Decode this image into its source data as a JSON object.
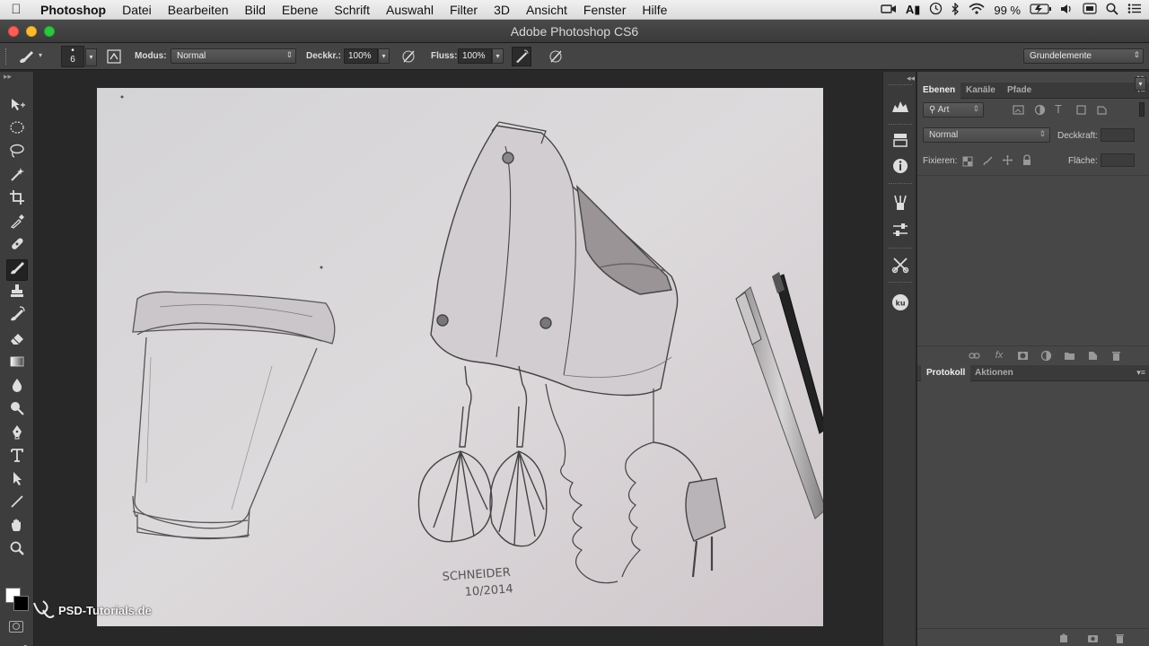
{
  "menubar": {
    "app_name": "Photoshop",
    "items": [
      "Datei",
      "Bearbeiten",
      "Bild",
      "Ebene",
      "Schrift",
      "Auswahl",
      "Filter",
      "3D",
      "Ansicht",
      "Fenster",
      "Hilfe"
    ],
    "battery": "99 %"
  },
  "window": {
    "title": "Adobe Photoshop CS6"
  },
  "options": {
    "brush_size": "6",
    "modus_label": "Modus:",
    "modus_value": "Normal",
    "deckkraft_label": "Deckkr.:",
    "deckkraft_value": "100%",
    "fluss_label": "Fluss:",
    "fluss_value": "100%",
    "workspace_value": "Grundelemente"
  },
  "tools": {
    "names": [
      "move-tool",
      "elliptical-marquee-tool",
      "lasso-tool",
      "magic-wand-tool",
      "crop-tool",
      "eyedropper-tool",
      "spot-healing-tool",
      "brush-tool",
      "clone-stamp-tool",
      "history-brush-tool",
      "eraser-tool",
      "gradient-tool",
      "blur-tool",
      "dodge-tool",
      "pen-tool",
      "type-tool",
      "path-selection-tool",
      "line-tool",
      "hand-tool",
      "zoom-tool"
    ],
    "active": "brush-tool"
  },
  "layers_panel": {
    "tabs": [
      "Ebenen",
      "Kanäle",
      "Pfade"
    ],
    "filter_value": "Art",
    "blend_mode": "Normal",
    "opacity_label": "Deckkraft:",
    "lock_label": "Fixieren:",
    "fill_label": "Fläche:"
  },
  "history_panel": {
    "tabs": [
      "Protokoll",
      "Aktionen"
    ]
  },
  "canvas": {
    "signature_line1": "SCHNEIDER",
    "signature_line2": "10/2014",
    "paper_color": "#d9d6d8"
  },
  "watermark": {
    "text": "PSD-Tutorials.de"
  },
  "colors": {
    "ui_dark": "#282828",
    "panel": "#474747",
    "close": "#fc5f57",
    "minimize": "#fdbc2e",
    "maximize": "#29c840"
  }
}
